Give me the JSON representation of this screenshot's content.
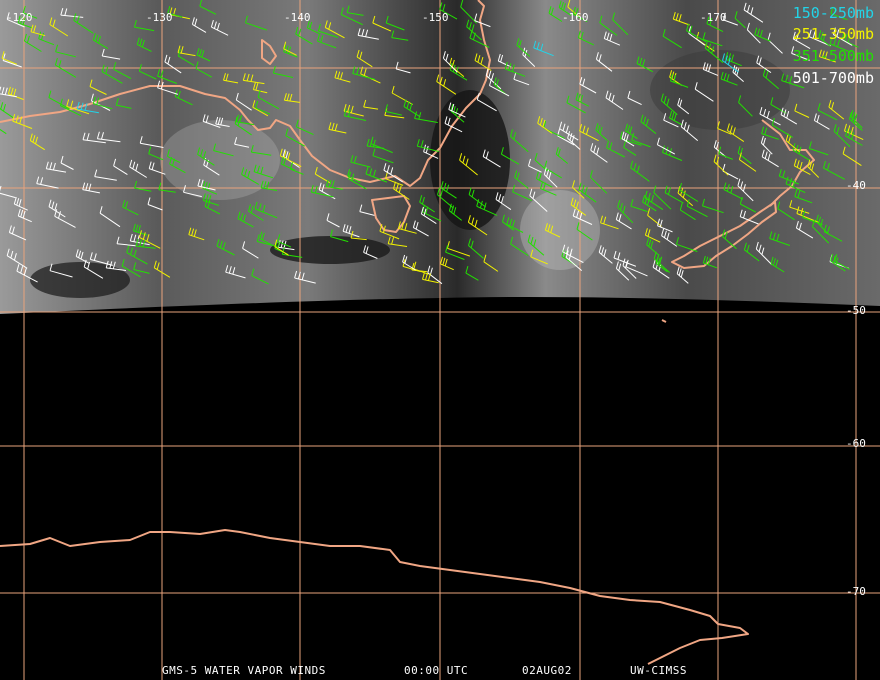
{
  "grid": {
    "lon_labels": [
      "-120",
      "-130",
      "-140",
      "-150",
      "-160",
      "-170"
    ],
    "lat_labels": [
      "-40",
      "-50",
      "-60",
      "-70"
    ],
    "line_color": "#e9a37c"
  },
  "legend": [
    {
      "label": "150-250mb",
      "color": "#22d4e8"
    },
    {
      "label": "251-350mb",
      "color": "#f2f200"
    },
    {
      "label": "351-500mb",
      "color": "#22e000"
    },
    {
      "label": "501-700mb",
      "color": "#ffffff"
    }
  ],
  "footer": {
    "product": "GMS-5 WATER VAPOR WINDS",
    "time": "00:00 UTC",
    "date": "02AUG02",
    "source": "UW-CIMSS"
  },
  "colors": {
    "coast": "#f0a684",
    "background": "#000000",
    "imagery_light": "#b8b8b8",
    "imagery_dark": "#202020"
  }
}
